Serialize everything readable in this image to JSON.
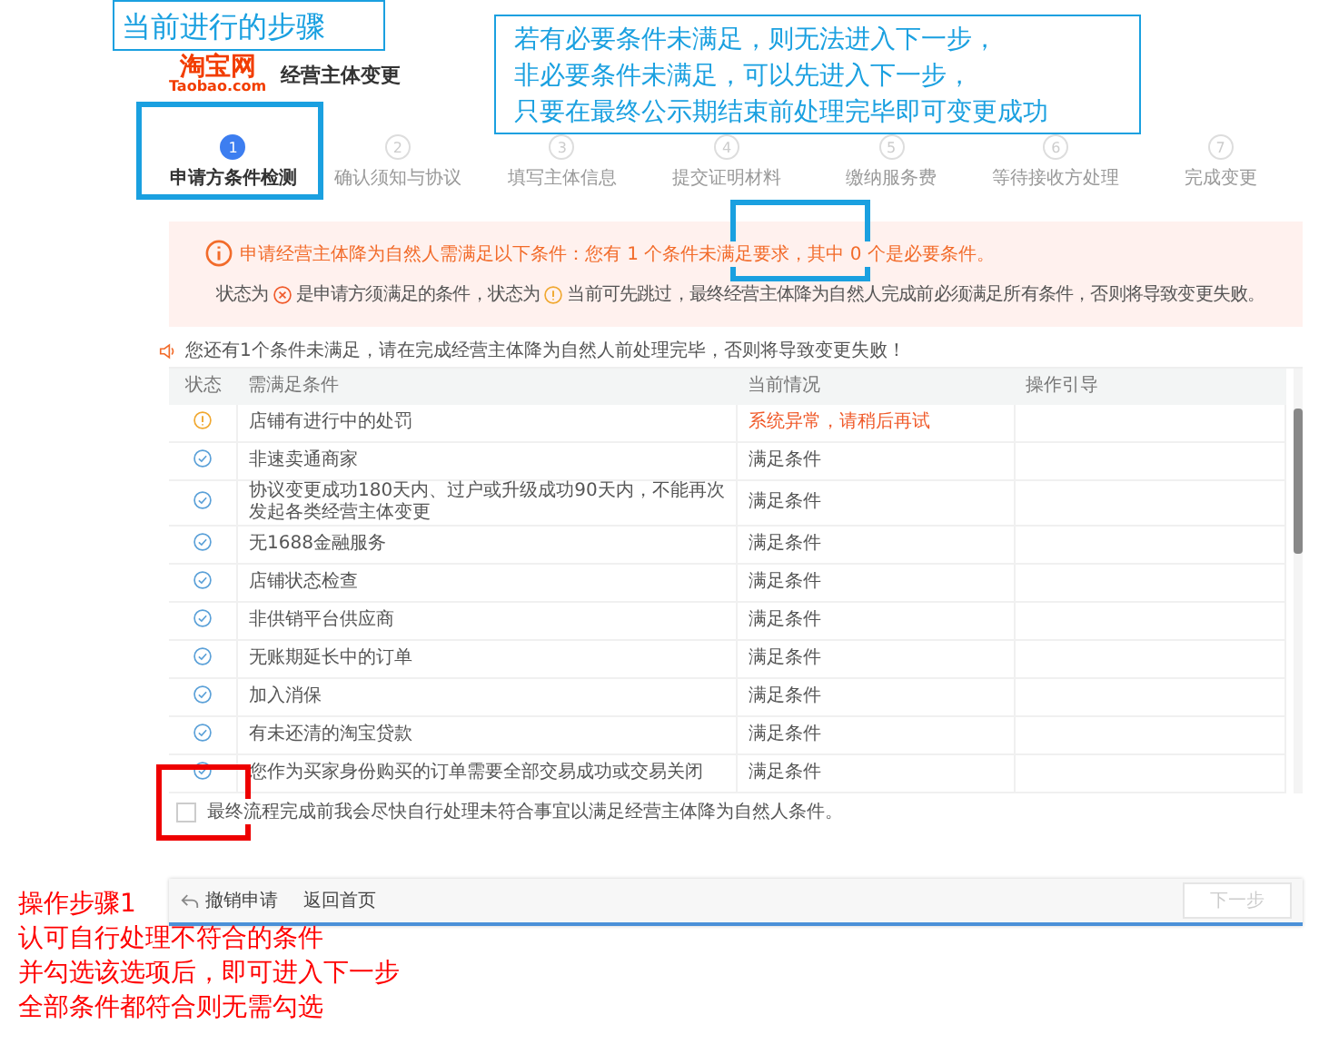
{
  "header": {
    "logo_cn": "淘宝网",
    "logo_en": "Taobao.com",
    "title": "经营主体变更"
  },
  "steps": [
    {
      "number": "1",
      "label": "申请方条件检测",
      "selected": true
    },
    {
      "number": "2",
      "label": "确认须知与协议",
      "selected": false
    },
    {
      "number": "3",
      "label": "填写主体信息",
      "selected": false
    },
    {
      "number": "4",
      "label": "提交证明材料",
      "selected": false
    },
    {
      "number": "5",
      "label": "缴纳服务费",
      "selected": false
    },
    {
      "number": "6",
      "label": "等待接收方处理",
      "selected": false
    },
    {
      "number": "7",
      "label": "完成变更",
      "selected": false
    }
  ],
  "alert": {
    "title": "申请经营主体降为自然人需满足以下条件：您有 1 个条件未满足要求，其中 0 个是必要条件。",
    "legend": [
      "状态为",
      "是申请方须满足的条件，状态为",
      "当前可先跳过，最终经营主体降为自然人完成前必须满足所有条件，否则将导致变更失败。"
    ]
  },
  "notice": "您还有1个条件未满足，请在完成经营主体降为自然人前处理完毕，否则将导致变更失败！",
  "table": {
    "columns": [
      "状态",
      "需满足条件",
      "当前情况",
      "操作引导"
    ],
    "rows": [
      {
        "kind": "warning",
        "condition": "店铺有进行中的处罚",
        "current": "系统异常，请稍后再试"
      },
      {
        "kind": "ok",
        "condition": "非速卖通商家",
        "current": "满足条件"
      },
      {
        "kind": "ok",
        "condition": "协议变更成功180天内、过户或升级成功90天内，不能再次发起各类经营主体变更",
        "current": "满足条件"
      },
      {
        "kind": "ok",
        "condition": "无1688金融服务",
        "current": "满足条件"
      },
      {
        "kind": "ok",
        "condition": "店铺状态检查",
        "current": "满足条件"
      },
      {
        "kind": "ok",
        "condition": "非供销平台供应商",
        "current": "满足条件"
      },
      {
        "kind": "ok",
        "condition": "无账期延长中的订单",
        "current": "满足条件"
      },
      {
        "kind": "ok",
        "condition": "加入消保",
        "current": "满足条件"
      },
      {
        "kind": "ok",
        "condition": "有未还清的淘宝贷款",
        "current": "满足条件"
      },
      {
        "kind": "ok",
        "condition": "您作为买家身份购买的订单需要全部交易成功或交易关闭",
        "current": "满足条件"
      }
    ]
  },
  "agreement": {
    "label": "最终流程完成前我会尽快自行处理未符合事宜以满足经营主体降为自然人条件。",
    "checked": false
  },
  "footer": {
    "cancel": "撤销申请",
    "home": "返回首页",
    "next": {
      "label": "下一步",
      "disabled": true
    }
  },
  "callouts": {
    "current_step": "当前进行的步骤",
    "conditions_note": [
      "若有必要条件未满足，则无法进入下一步，",
      "非必要条件未满足，可以先进入下一步，",
      "只要在最终公示期结束前处理完毕即可变更成功"
    ],
    "operation_note": [
      "操作步骤1",
      "认可自行处理不符合的条件",
      "并勾选该选项后，即可进入下一步",
      "全部条件都符合则无需勾选"
    ]
  }
}
